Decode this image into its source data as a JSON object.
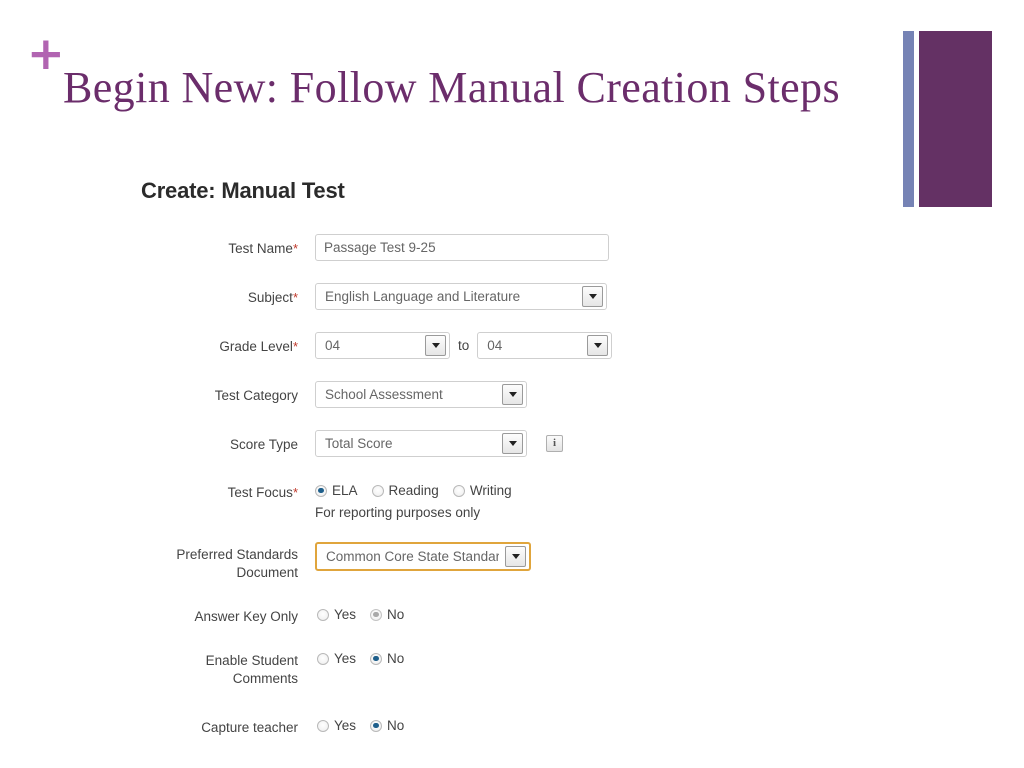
{
  "slide": {
    "plus_glyph": "+",
    "title": "Begin New: Follow Manual Creation Steps",
    "accent_purple": "#643164",
    "accent_blue": "#7683B5",
    "title_color": "#6B2D6B",
    "plus_color": "#B164B1"
  },
  "form": {
    "heading": "Create: Manual Test",
    "required_marker": "*",
    "to_word": "to",
    "info_glyph": "i",
    "rows": {
      "test_name": {
        "label": "Test Name",
        "required": true,
        "value": "Passage Test 9-25"
      },
      "subject": {
        "label": "Subject",
        "required": true,
        "value": "English Language and Literature"
      },
      "grade_level": {
        "label": "Grade Level",
        "required": true,
        "from_value": "04",
        "to_value": "04"
      },
      "test_category": {
        "label": "Test Category",
        "required": false,
        "value": "School Assessment"
      },
      "score_type": {
        "label": "Score Type",
        "required": false,
        "value": "Total Score"
      },
      "test_focus": {
        "label": "Test Focus",
        "required": true,
        "options": [
          "ELA",
          "Reading",
          "Writing"
        ],
        "selected": "ELA",
        "helper": "For reporting purposes only"
      },
      "preferred_standards": {
        "label_line1": "Preferred Standards",
        "label_line2": "Document",
        "required": false,
        "value": "Common Core State Standar",
        "focused": true,
        "focus_color": "#E0A53C"
      },
      "answer_key_only": {
        "label": "Answer Key Only",
        "options": [
          "Yes",
          "No"
        ],
        "selected": "No",
        "muted": true
      },
      "enable_student_comments": {
        "label_line1": "Enable Student",
        "label_line2": "Comments",
        "options": [
          "Yes",
          "No"
        ],
        "selected": "No",
        "muted": false
      },
      "capture_teacher": {
        "label": "Capture teacher",
        "options": [
          "Yes",
          "No"
        ],
        "selected": "No",
        "muted": false
      }
    }
  }
}
